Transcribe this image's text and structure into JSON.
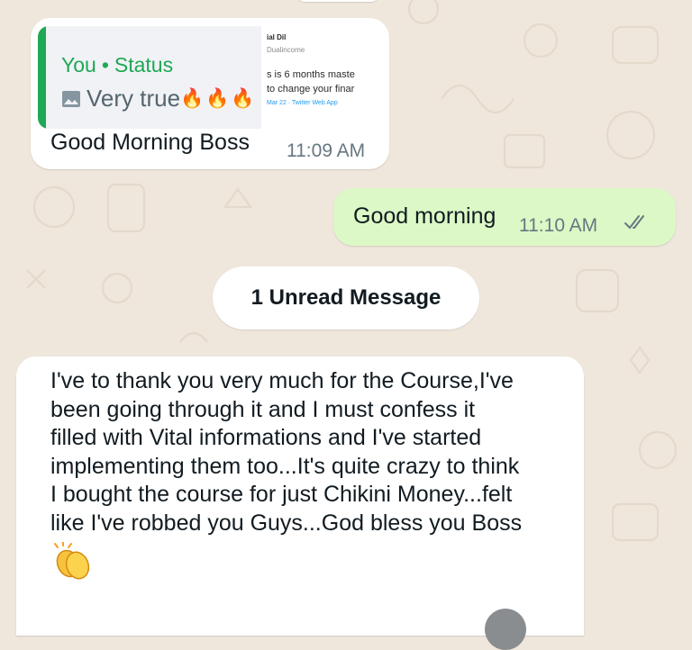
{
  "chat": {
    "status_reply": {
      "author": "You",
      "separator": "•",
      "source": "Status",
      "quote_text": "Very true",
      "quote_emoji": "🔥🔥🔥",
      "thumbnail_lines": [
        "ial Dil",
        "Dualincome",
        "s is 6 months maste",
        "to change your finar",
        "Mar 22 · Twitter Web App"
      ],
      "message": "Good Morning Boss",
      "time": "11:09 AM"
    },
    "outgoing": {
      "message": "Good morning",
      "time": "11:10 AM",
      "status_icon": "double-check-icon"
    },
    "unread_label": "1 Unread Message",
    "incoming_long": {
      "lines": [
        "I've to thank you very much for the Course,I've",
        "been going through it and I must confess it",
        "filled with Vital informations and I've started",
        "implementing them too...It's quite crazy to think",
        "I bought the course for just Chikini Money...felt",
        "like I've robbed you Guys...God bless you Boss"
      ],
      "emoji_icon": "clapping-hands-icon"
    }
  },
  "colors": {
    "wallpaper": "#efe7dc",
    "incoming_bubble": "#ffffff",
    "outgoing_bubble": "#dcf8c6",
    "accent_green": "#1fa855",
    "meta_gray": "#667781",
    "read_tick": "#667781"
  }
}
